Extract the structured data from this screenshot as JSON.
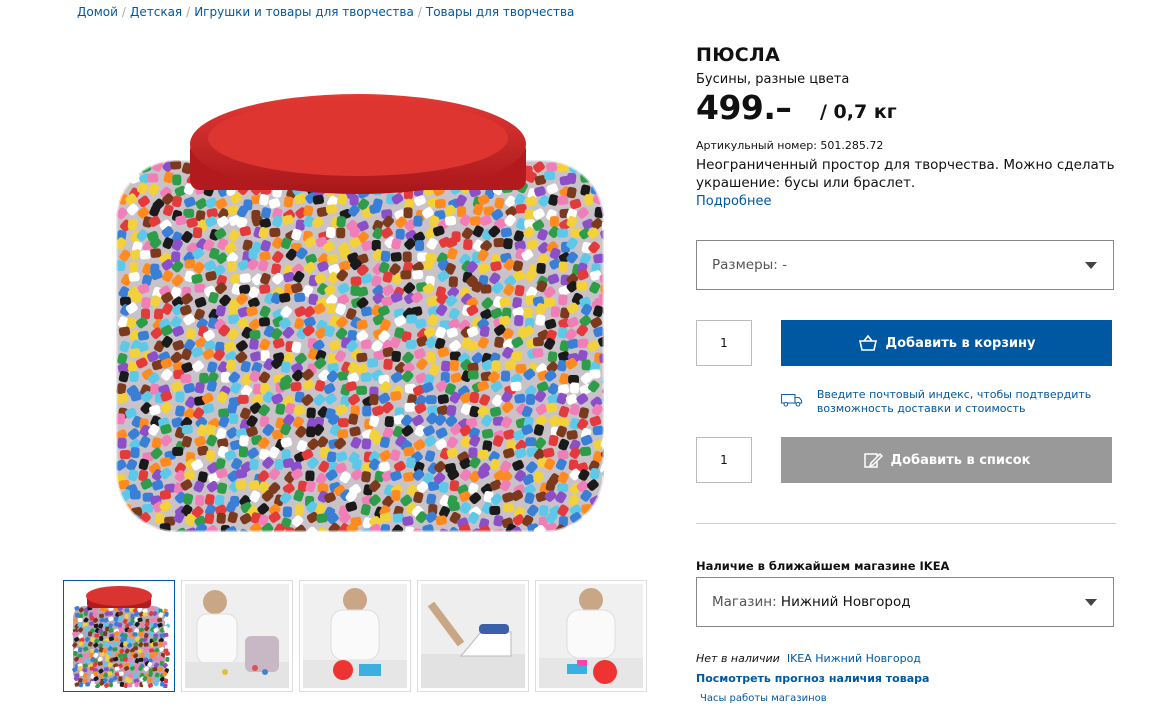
{
  "breadcrumbs": [
    "Домой",
    "Детская",
    "Игрушки и товары для творчества",
    "Товары для творчества"
  ],
  "product": {
    "name": "ПЮСЛА",
    "subtitle": "Бусины, разные цвета",
    "price": "499.–",
    "unit": "/ 0,7 кг",
    "article": "Артикульный номер: 501.285.72",
    "description": "Неограниченный простор для творчества. Можно сделать украшение: бусы или браслет.",
    "more_link": "Подробнее"
  },
  "size_select": {
    "label": "Размеры:",
    "value": "-"
  },
  "cart": {
    "quantity": "1",
    "button": "Добавить в корзину"
  },
  "delivery": {
    "text": "Введите почтовый индекс, чтобы подтвердить возможность доставки и стоимость"
  },
  "list": {
    "quantity": "1",
    "button": "Добавить в список"
  },
  "availability": {
    "heading": "Наличие в ближайшем магазине IKEA",
    "store_label": "Магазин:",
    "store_value": "Нижний Новгород",
    "status": "Нет в наличии",
    "store_link": "IKEA Нижний Новгород",
    "forecast_link": "Посмотреть прогноз наличия товара",
    "hours_link": "Часы работы магазинов"
  },
  "colors": {
    "accent": "#0058a3",
    "lid": "#d42a2a",
    "button_grey": "#999999"
  }
}
